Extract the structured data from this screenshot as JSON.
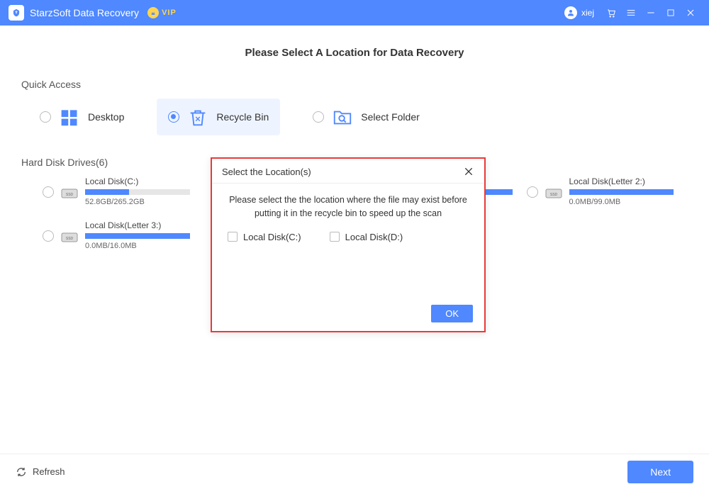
{
  "titlebar": {
    "app_title": "StarzSoft Data Recovery",
    "vip_label": "VIP",
    "user_name": "xiej"
  },
  "heading": "Please Select A Location for Data Recovery",
  "quick_access": {
    "section_title": "Quick Access",
    "items": [
      {
        "label": "Desktop"
      },
      {
        "label": "Recycle Bin"
      },
      {
        "label": "Select Folder"
      }
    ]
  },
  "drives": {
    "section_title": "Hard Disk Drives(6)",
    "list": [
      {
        "name": "Local Disk(C:)",
        "size": "52.8GB/265.2GB",
        "fill_pct": 42
      },
      {
        "name": "",
        "size": "",
        "fill_pct": 100
      },
      {
        "name": "",
        "size": "",
        "fill_pct": 100
      },
      {
        "name": "Local Disk(Letter 2:)",
        "size": "0.0MB/99.0MB",
        "fill_pct": 100
      },
      {
        "name": "Local Disk(Letter 3:)",
        "size": "0.0MB/16.0MB",
        "fill_pct": 100
      }
    ]
  },
  "modal": {
    "title": "Select the Location(s)",
    "message": "Please select the the location where the file may exist before putting it in the recycle bin to speed up the scan",
    "options": [
      {
        "label": "Local Disk(C:)"
      },
      {
        "label": "Local Disk(D:)"
      }
    ],
    "ok_label": "OK"
  },
  "footer": {
    "refresh_label": "Refresh",
    "next_label": "Next"
  }
}
